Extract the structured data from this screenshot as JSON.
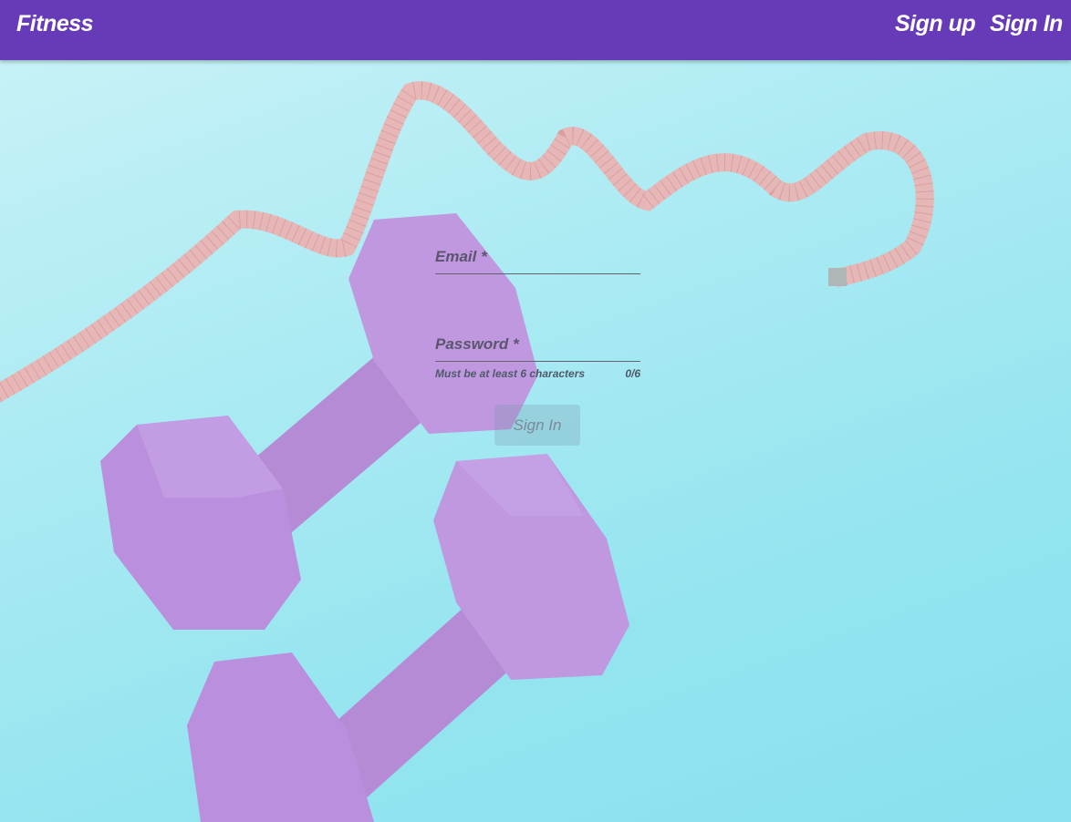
{
  "appbar": {
    "brand": "Fitness",
    "signup_label": "Sign up",
    "signin_label": "Sign In",
    "color": "#673ab7"
  },
  "form": {
    "email_label": "Email *",
    "password_label": "Password *",
    "password_hint": "Must be at least 6 characters",
    "password_counter": "0/6",
    "submit_label": "Sign In"
  },
  "background": {
    "description_icon": "dumbbells-and-measuring-tape-photo",
    "colors": {
      "backdrop": "#8fe3ef",
      "dumbbell": "#b77ad8",
      "tape": "#f09a98"
    }
  }
}
